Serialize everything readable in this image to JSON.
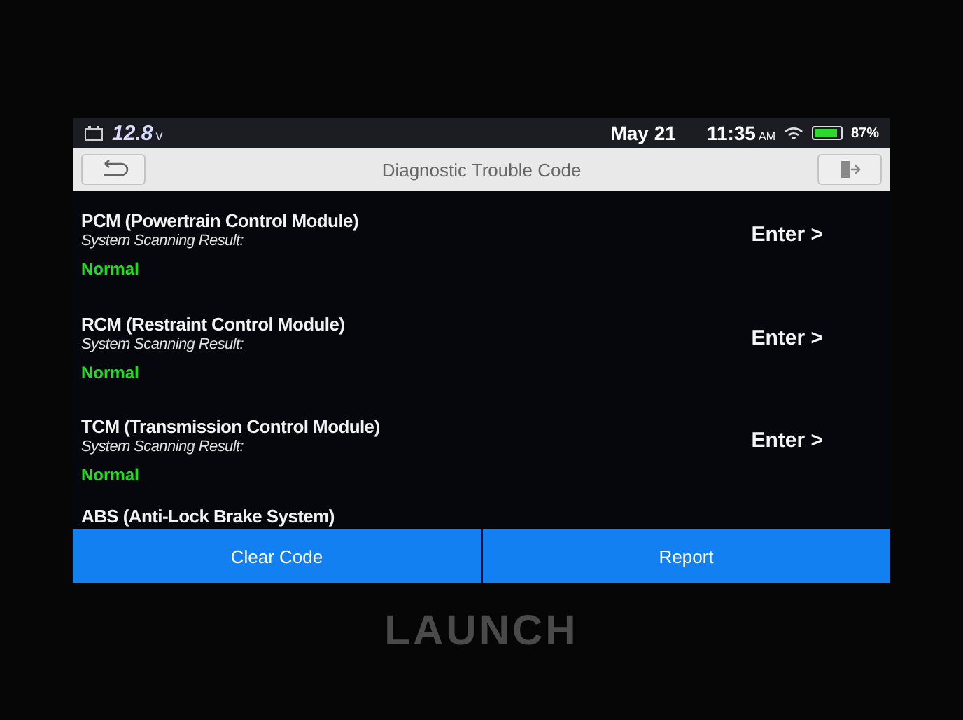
{
  "status_bar": {
    "voltage": "12.8",
    "voltage_unit": "v",
    "date": "May 21",
    "time": "11:35",
    "meridiem": "AM",
    "battery": "87%",
    "battery_meter": {
      "level": 0.87
    }
  },
  "title_bar": {
    "title": "Diagnostic Trouble Code"
  },
  "modules": [
    {
      "name": "PCM (Powertrain Control Module)",
      "result_label": "System Scanning Result:",
      "result": "Normal",
      "action": "Enter >"
    },
    {
      "name": "RCM (Restraint Control Module)",
      "result_label": "System Scanning Result:",
      "result": "Normal",
      "action": "Enter >"
    },
    {
      "name": "TCM (Transmission Control Module)",
      "result_label": "System Scanning Result:",
      "result": "Normal",
      "action": "Enter >"
    },
    {
      "name": "ABS (Anti-Lock Brake System)"
    }
  ],
  "buttons": [
    "Clear Code",
    "Report"
  ],
  "device": {
    "brand": "LAUNCH"
  }
}
